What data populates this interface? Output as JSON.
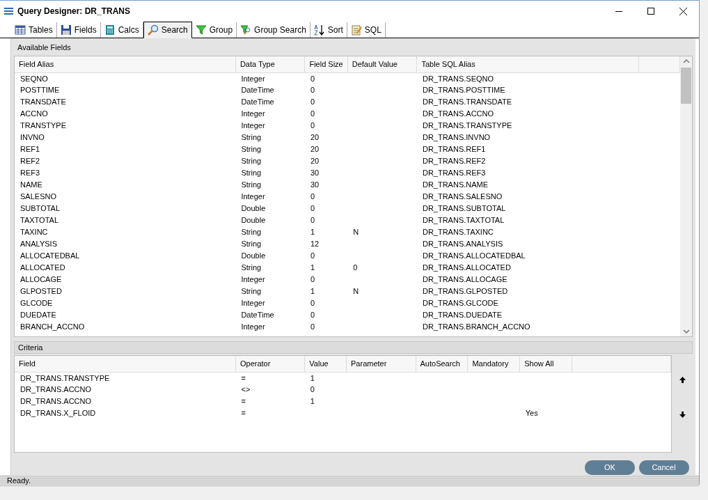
{
  "window": {
    "title": "Query Designer: DR_TRANS"
  },
  "tabs": [
    {
      "label": "Tables",
      "selected": false
    },
    {
      "label": "Fields",
      "selected": false
    },
    {
      "label": "Calcs",
      "selected": false
    },
    {
      "label": "Search",
      "selected": true
    },
    {
      "label": "Group",
      "selected": false
    },
    {
      "label": "Group Search",
      "selected": false
    },
    {
      "label": "Sort",
      "selected": false
    },
    {
      "label": "SQL",
      "selected": false
    }
  ],
  "available_fields": {
    "title": "Available Fields",
    "columns": [
      "Field Alias",
      "Data Type",
      "Field Size",
      "Default Value",
      "Table SQL Alias"
    ],
    "rows": [
      [
        "SEQNO",
        "Integer",
        "0",
        "",
        "DR_TRANS.SEQNO"
      ],
      [
        "POSTTIME",
        "DateTime",
        "0",
        "",
        "DR_TRANS.POSTTIME"
      ],
      [
        "TRANSDATE",
        "DateTime",
        "0",
        "",
        "DR_TRANS.TRANSDATE"
      ],
      [
        "ACCNO",
        "Integer",
        "0",
        "",
        "DR_TRANS.ACCNO"
      ],
      [
        "TRANSTYPE",
        "Integer",
        "0",
        "",
        "DR_TRANS.TRANSTYPE"
      ],
      [
        "INVNO",
        "String",
        "20",
        "",
        "DR_TRANS.INVNO"
      ],
      [
        "REF1",
        "String",
        "20",
        "",
        "DR_TRANS.REF1"
      ],
      [
        "REF2",
        "String",
        "20",
        "",
        "DR_TRANS.REF2"
      ],
      [
        "REF3",
        "String",
        "30",
        "",
        "DR_TRANS.REF3"
      ],
      [
        "NAME",
        "String",
        "30",
        "",
        "DR_TRANS.NAME"
      ],
      [
        "SALESNO",
        "Integer",
        "0",
        "",
        "DR_TRANS.SALESNO"
      ],
      [
        "SUBTOTAL",
        "Double",
        "0",
        "",
        "DR_TRANS.SUBTOTAL"
      ],
      [
        "TAXTOTAL",
        "Double",
        "0",
        "",
        "DR_TRANS.TAXTOTAL"
      ],
      [
        "TAXINC",
        "String",
        "1",
        "N",
        "DR_TRANS.TAXINC"
      ],
      [
        "ANALYSIS",
        "String",
        "12",
        "",
        "DR_TRANS.ANALYSIS"
      ],
      [
        "ALLOCATEDBAL",
        "Double",
        "0",
        "",
        "DR_TRANS.ALLOCATEDBAL"
      ],
      [
        "ALLOCATED",
        "String",
        "1",
        "0",
        "DR_TRANS.ALLOCATED"
      ],
      [
        "ALLOCAGE",
        "Integer",
        "0",
        "",
        "DR_TRANS.ALLOCAGE"
      ],
      [
        "GLPOSTED",
        "String",
        "1",
        "N",
        "DR_TRANS.GLPOSTED"
      ],
      [
        "GLCODE",
        "Integer",
        "0",
        "",
        "DR_TRANS.GLCODE"
      ],
      [
        "DUEDATE",
        "DateTime",
        "0",
        "",
        "DR_TRANS.DUEDATE"
      ],
      [
        "BRANCH_ACCNO",
        "Integer",
        "0",
        "",
        "DR_TRANS.BRANCH_ACCNO"
      ]
    ]
  },
  "criteria": {
    "title": "Criteria",
    "columns": [
      "Field",
      "Operator",
      "Value",
      "Parameter",
      "AutoSearch",
      "Mandatory",
      "Show All"
    ],
    "rows": [
      [
        "DR_TRANS.TRANSTYPE",
        "=",
        "1",
        "",
        "",
        "",
        ""
      ],
      [
        "DR_TRANS.ACCNO",
        "<>",
        "0",
        "",
        "",
        "",
        ""
      ],
      [
        "DR_TRANS.ACCNO",
        "=",
        "1",
        "",
        "",
        "",
        ""
      ],
      [
        "DR_TRANS.X_FLOID",
        "=",
        "",
        "",
        "",
        "",
        "Yes"
      ]
    ]
  },
  "buttons": [
    "OK",
    "Cancel"
  ],
  "status_bar": "Ready."
}
